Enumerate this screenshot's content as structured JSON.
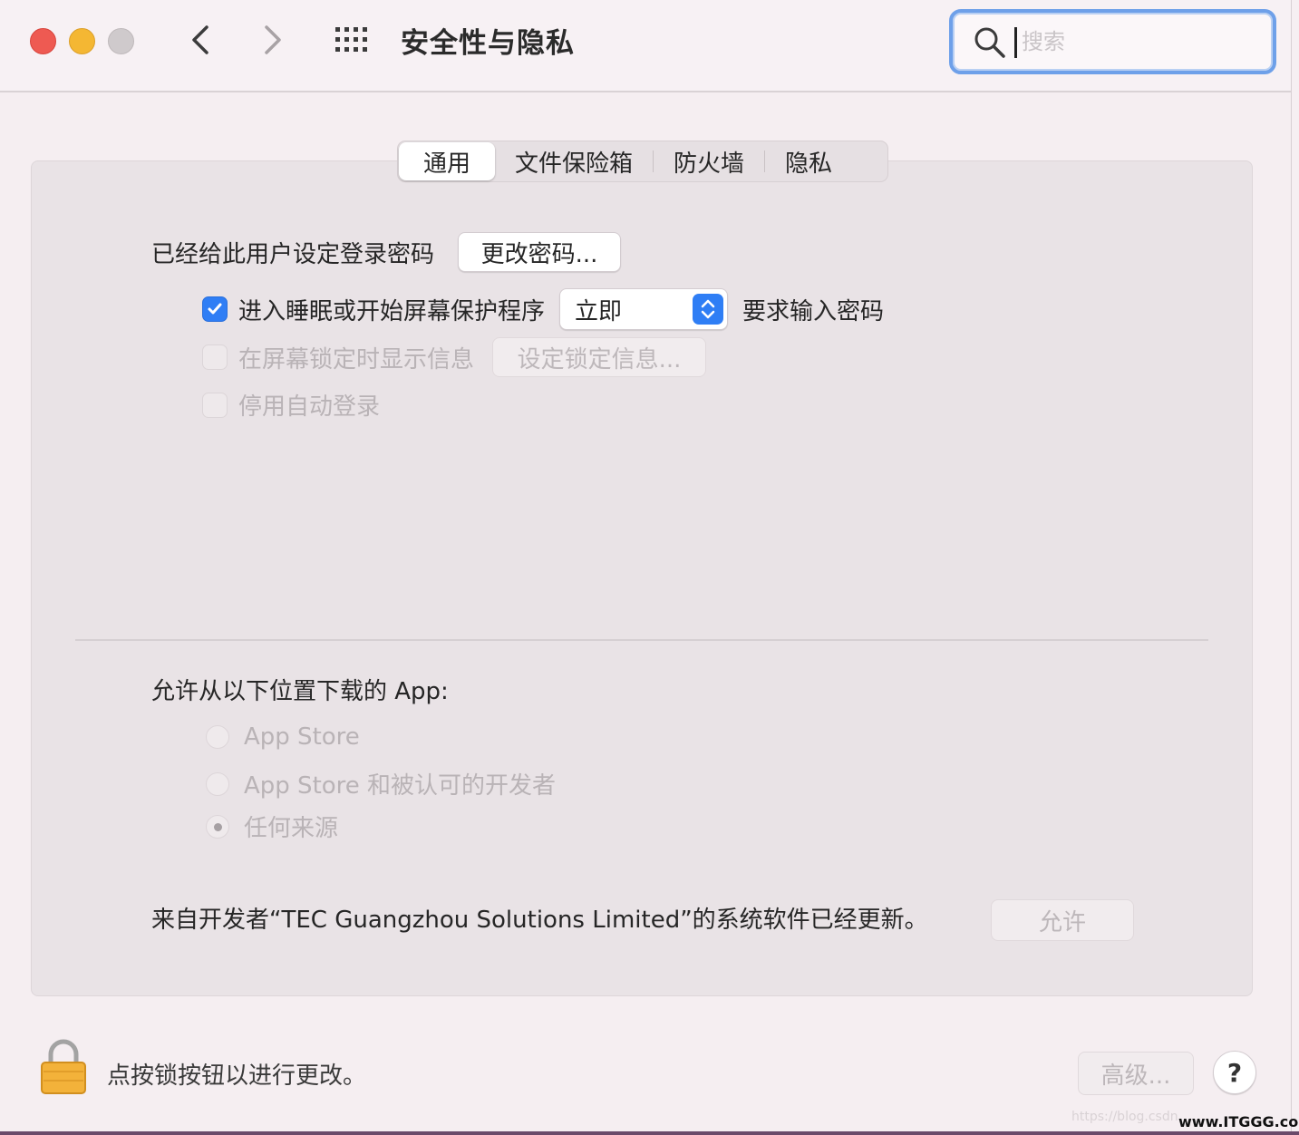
{
  "window": {
    "title": "安全性与隐私"
  },
  "search": {
    "placeholder": "搜索"
  },
  "tabs": [
    {
      "label": "通用",
      "active": true
    },
    {
      "label": "文件保险箱",
      "active": false
    },
    {
      "label": "防火墙",
      "active": false
    },
    {
      "label": "隐私",
      "active": false
    }
  ],
  "general": {
    "password_label": "已经给此用户设定登录密码",
    "change_password_button": "更改密码...",
    "sleep_checkbox_label": "进入睡眠或开始屏幕保护程序",
    "sleep_checkbox_checked": true,
    "sleep_select_value": "立即",
    "sleep_suffix": "要求输入密码",
    "lock_message_label": "在屏幕锁定时显示信息",
    "lock_message_checked": false,
    "lock_message_button": "设定锁定信息...",
    "disable_autologin_label": "停用自动登录",
    "disable_autologin_checked": false
  },
  "downloads": {
    "heading": "允许从以下位置下载的 App:",
    "options": [
      {
        "label": "App Store",
        "selected": false
      },
      {
        "label": "App Store 和被认可的开发者",
        "selected": false
      },
      {
        "label": "任何来源",
        "selected": true
      }
    ]
  },
  "system_software": {
    "message": "来自开发者“TEC Guangzhou Solutions Limited”的系统软件已经更新。",
    "allow_button": "允许"
  },
  "footer": {
    "lock_text": "点按锁按钮以进行更改。",
    "advanced_button": "高级...",
    "help_button": "?"
  },
  "watermarks": {
    "faint": "https://blog.csdn",
    "site": "www.ITGGG.com"
  },
  "colors": {
    "accent": "#2f7ef5",
    "close": "#ee5a52",
    "minimize": "#f4b733",
    "maximize": "#cfcacc",
    "lock": "#f3b23a"
  }
}
